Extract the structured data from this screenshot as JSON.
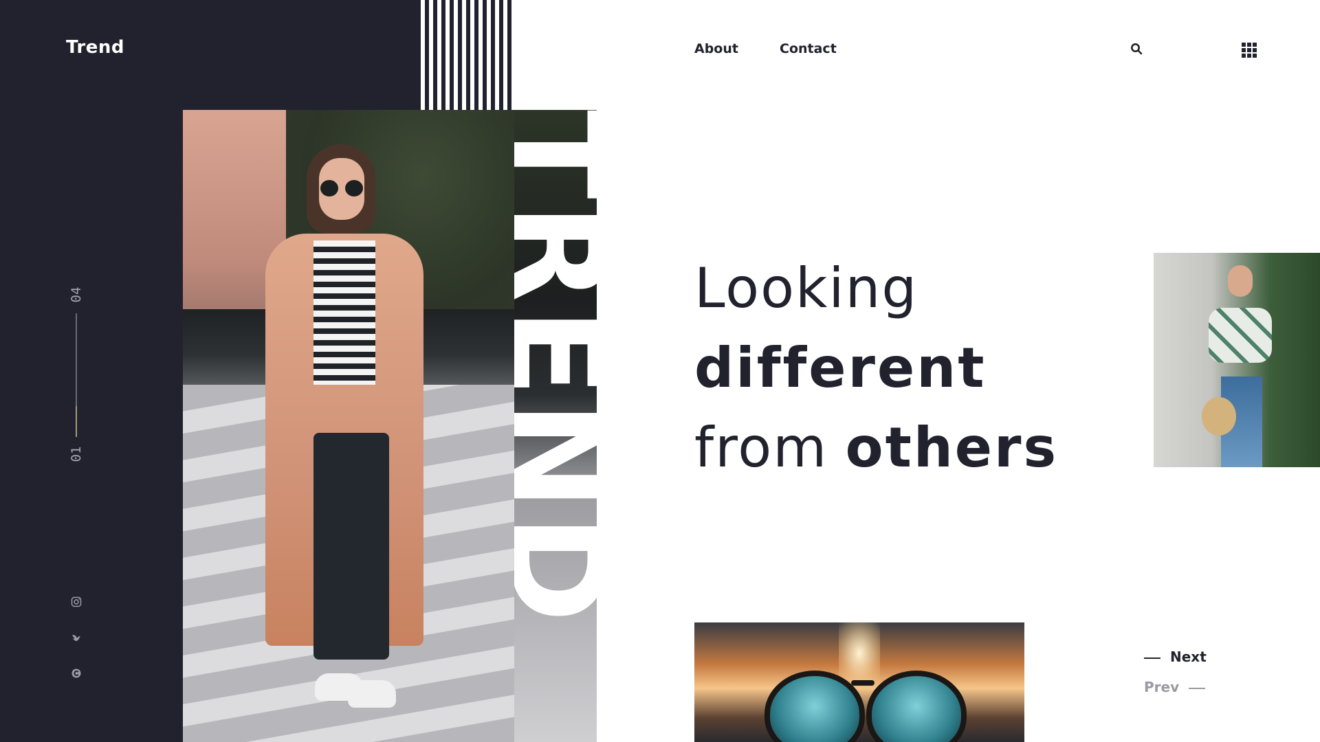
{
  "brand": {
    "name": "Trend"
  },
  "nav": {
    "items": [
      {
        "label": "About"
      },
      {
        "label": "Contact"
      }
    ]
  },
  "header_icons": {
    "search": "search-icon",
    "menu": "grid-menu-icon"
  },
  "slide_counter": {
    "current": "01",
    "total": "04",
    "progress": 0.25
  },
  "socials": [
    {
      "icon": "instagram-icon"
    },
    {
      "icon": "twitter-icon"
    },
    {
      "icon": "pinterest-icon"
    }
  ],
  "vertical_word": "TREND",
  "headline": {
    "line1": "Looking",
    "line2": "different",
    "line3_light": "from",
    "line3_bold": "others"
  },
  "pager": {
    "next": "Next",
    "prev": "Prev"
  },
  "colors": {
    "dark": "#22222f",
    "text": "#22222e",
    "muted": "#9a9aa2",
    "accent_line": "#a39a76"
  }
}
